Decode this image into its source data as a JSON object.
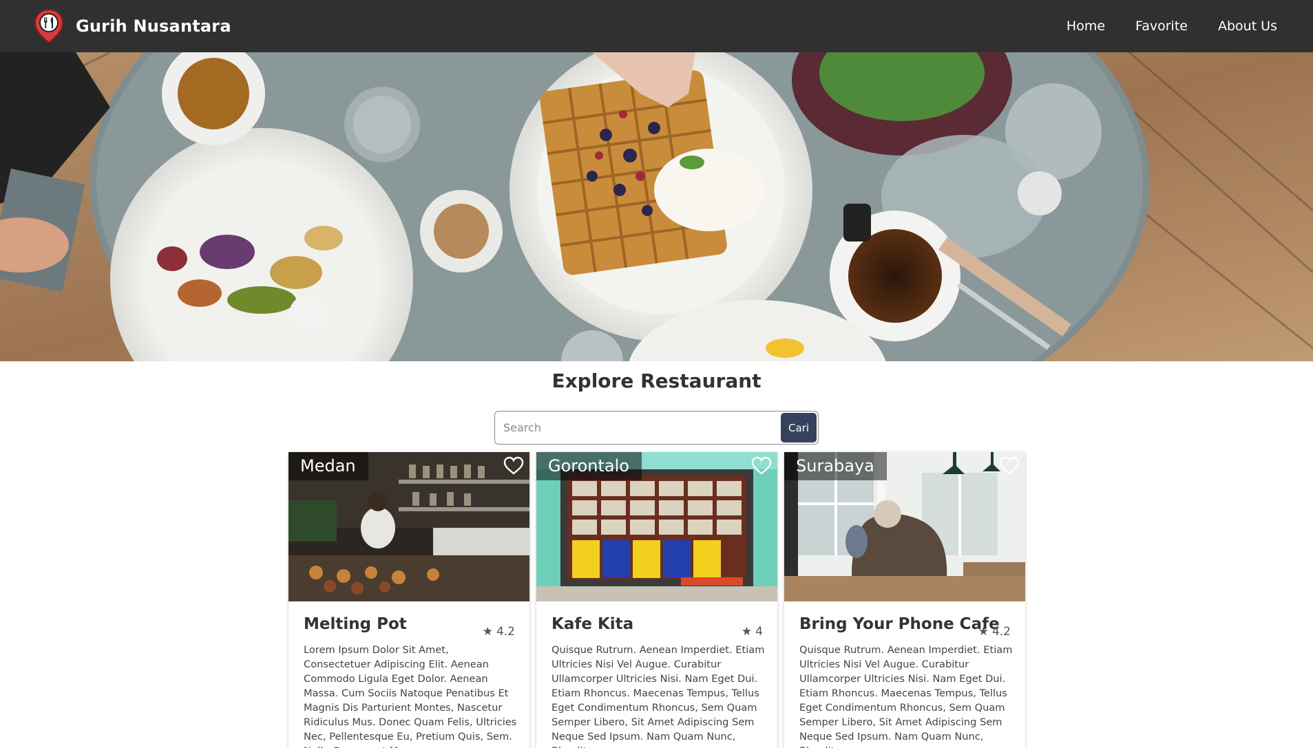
{
  "header": {
    "brand": "Gurih Nusantara",
    "nav": [
      "Home",
      "Favorite",
      "About Us"
    ]
  },
  "hero": {
    "image": "restaurant-table-food-photo"
  },
  "main": {
    "title": "Explore Restaurant",
    "search": {
      "placeholder": "Search",
      "button": "Cari"
    }
  },
  "restaurants": [
    {
      "city": "Medan",
      "name": "Melting Pot",
      "rating": "4.2",
      "description": "Lorem Ipsum Dolor Sit Amet, Consectetuer Adipiscing Elit. Aenean Commodo Ligula Eget Dolor. Aenean Massa. Cum Sociis Natoque Penatibus Et Magnis Dis Parturient Montes, Nascetur Ridiculus Mus. Donec Quam Felis, Ultricies Nec, Pellentesque Eu, Pretium Quis, Sem. Nulla Consequat Massa"
    },
    {
      "city": "Gorontalo",
      "name": "Kafe Kita",
      "rating": "4",
      "description": "Quisque Rutrum. Aenean Imperdiet. Etiam Ultricies Nisi Vel Augue. Curabitur Ullamcorper Ultricies Nisi. Nam Eget Dui. Etiam Rhoncus. Maecenas Tempus, Tellus Eget Condimentum Rhoncus, Sem Quam Semper Libero, Sit Amet Adipiscing Sem Neque Sed Ipsum. Nam Quam Nunc, Blandit"
    },
    {
      "city": "Surabaya",
      "name": "Bring Your Phone Cafe",
      "rating": "4.2",
      "description": "Quisque Rutrum. Aenean Imperdiet. Etiam Ultricies Nisi Vel Augue. Curabitur Ullamcorper Ultricies Nisi. Nam Eget Dui. Etiam Rhoncus. Maecenas Tempus, Tellus Eget Condimentum Rhoncus, Sem Quam Semper Libero, Sit Amet Adipiscing Sem Neque Sed Ipsum. Nam Quam Nunc, Blandit"
    }
  ]
}
